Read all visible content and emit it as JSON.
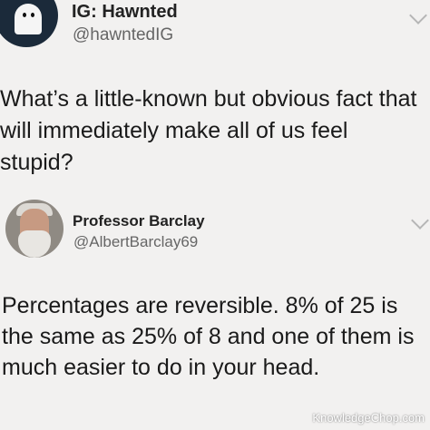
{
  "tweet1": {
    "display_name": "IG: Hawnted",
    "handle": "@hawntedIG",
    "text": "What’s a little-known but obvious fact that will immediately make all of us feel stupid?",
    "avatar_icon": "ghost-avatar",
    "menu_icon": "chevron-down-icon"
  },
  "tweet2": {
    "display_name": "Professor Barclay",
    "handle": "@AlbertBarclay69",
    "text": "Percentages are reversible.  8% of 25 is the same as 25% of 8 and one of them is much easier to do in your head.",
    "avatar_icon": "professor-avatar",
    "menu_icon": "chevron-down-icon"
  },
  "watermark": "KnowledgeChop.com",
  "colors": {
    "background": "#f2f1f0",
    "text": "#1a1a1a",
    "handle": "#666666"
  }
}
